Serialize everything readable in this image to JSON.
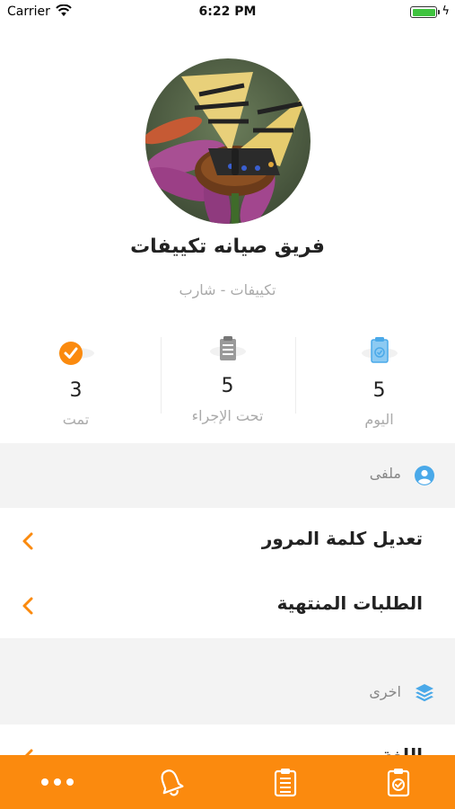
{
  "status_bar": {
    "carrier": "Carrier",
    "time": "6:22 PM",
    "battery_level": 1.0
  },
  "profile": {
    "name": "فريق صيانه تكييفات",
    "subtitle": "تكييفات - شارب",
    "avatar_icon": "butterfly-photo"
  },
  "stats": [
    {
      "count": "5",
      "label": "اليوم",
      "icon": "clipboard-check-icon"
    },
    {
      "count": "5",
      "label": "تحت الإجراء",
      "icon": "clipboard-list-icon"
    },
    {
      "count": "3",
      "label": "تمت",
      "icon": "check-circle-icon"
    }
  ],
  "sections": {
    "profile_header": {
      "title": "ملفى",
      "icon": "user-circle-icon"
    },
    "profile_items": [
      {
        "label": "تعديل كلمة المرور"
      },
      {
        "label": "الطلبات المنتهية"
      }
    ],
    "other_header": {
      "title": "اخرى",
      "icon": "layers-icon"
    },
    "other_items": [
      {
        "label": "اللغة"
      }
    ]
  },
  "tab_bar": {
    "tabs": [
      {
        "icon": "clipboard-check-icon"
      },
      {
        "icon": "clipboard-list-icon"
      },
      {
        "icon": "bell-icon"
      },
      {
        "icon": "more-dots-icon"
      }
    ]
  },
  "colors": {
    "accent": "#fb8a0e",
    "icon_blue": "#4aa9e9",
    "text_gray": "#aaaaaa",
    "section_bg": "#f3f3f3"
  }
}
